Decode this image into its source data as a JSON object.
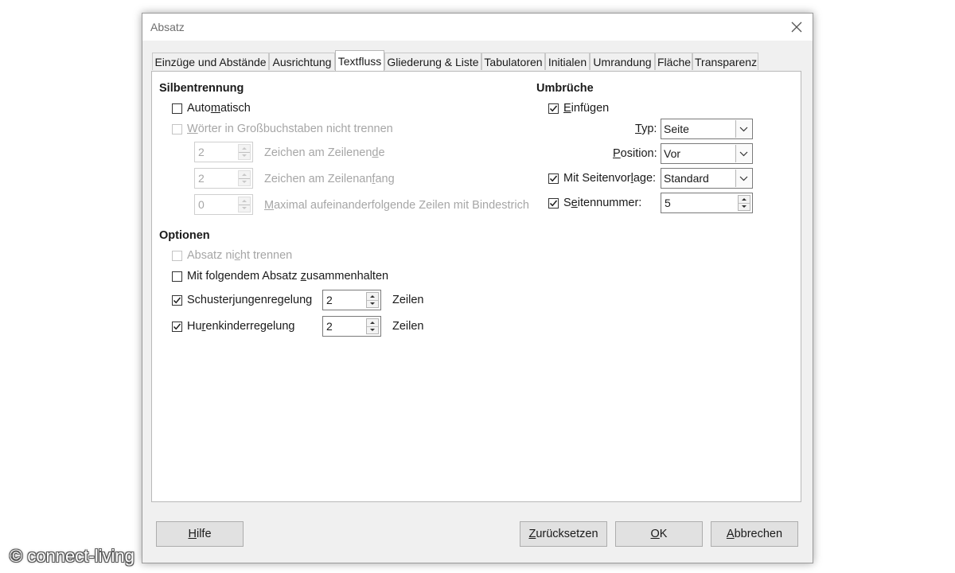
{
  "window": {
    "title": "Absatz"
  },
  "tabs": [
    {
      "label": "Einzüge und Abstände"
    },
    {
      "label": "Ausrichtung"
    },
    {
      "label": "Textfluss"
    },
    {
      "label": "Gliederung & Liste"
    },
    {
      "label": "Tabulatoren"
    },
    {
      "label": "Initialen"
    },
    {
      "label": "Umrandung"
    },
    {
      "label": "Fläche"
    },
    {
      "label": "Transparenz"
    }
  ],
  "hyphenation": {
    "header": "Silbentrennung",
    "automatic": {
      "pre": "Auto",
      "ul": "m",
      "post": "atisch",
      "checked": false
    },
    "caps": {
      "ul": "W",
      "post": "örter in Großbuchstaben nicht trennen",
      "checked": false
    },
    "line_end": {
      "value": "2",
      "pre": "Zeichen am Zeilenen",
      "ul": "d",
      "post": "e"
    },
    "line_begin": {
      "value": "2",
      "pre": "Zeichen am Zeilenan",
      "ul": "f",
      "post": "ang"
    },
    "max_lines": {
      "value": "0",
      "ul": "M",
      "post": "aximal aufeinanderfolgende Zeilen mit Bindestrich"
    }
  },
  "options": {
    "header": "Optionen",
    "keep_together": {
      "pre": "Absatz ni",
      "ul": "c",
      "post": "ht trennen",
      "checked": false
    },
    "keep_next": {
      "pre": "Mit folgendem Absatz ",
      "ul": "z",
      "post": "usammenhalten",
      "checked": false
    },
    "orphan": {
      "pre": "Schuster",
      "ul": "j",
      "post": "ungenregelung",
      "checked": true,
      "value": "2",
      "unit": "Zeilen"
    },
    "widow": {
      "pre": "Hu",
      "ul": "r",
      "post": "enkinderregelung",
      "checked": true,
      "value": "2",
      "unit": "Zeilen"
    }
  },
  "breaks": {
    "header": "Umbrüche",
    "insert": {
      "ul": "E",
      "post": "infügen",
      "checked": true
    },
    "type": {
      "ul": "T",
      "post": "yp:",
      "value": "Seite"
    },
    "position": {
      "ul": "P",
      "post": "osition:",
      "value": "Vor"
    },
    "page_style": {
      "pre": "Mit Seitenvor",
      "ul": "l",
      "post": "age:",
      "checked": true,
      "value": "Standard"
    },
    "page_number": {
      "pre": "S",
      "ul": "e",
      "post": "itennummer:",
      "checked": true,
      "value": "5"
    }
  },
  "footer": {
    "help": {
      "ul": "H",
      "post": "ilfe"
    },
    "reset": {
      "ul": "Z",
      "post": "urücksetzen"
    },
    "ok": {
      "ul": "O",
      "post": "K"
    },
    "cancel": {
      "ul": "A",
      "post": "bbrechen"
    }
  },
  "watermark": "© connect-living",
  "colors": {
    "disabled_text": "#a6a6a6",
    "panel_bg": "#ffffff",
    "dialog_bg": "#f0f0f0"
  }
}
